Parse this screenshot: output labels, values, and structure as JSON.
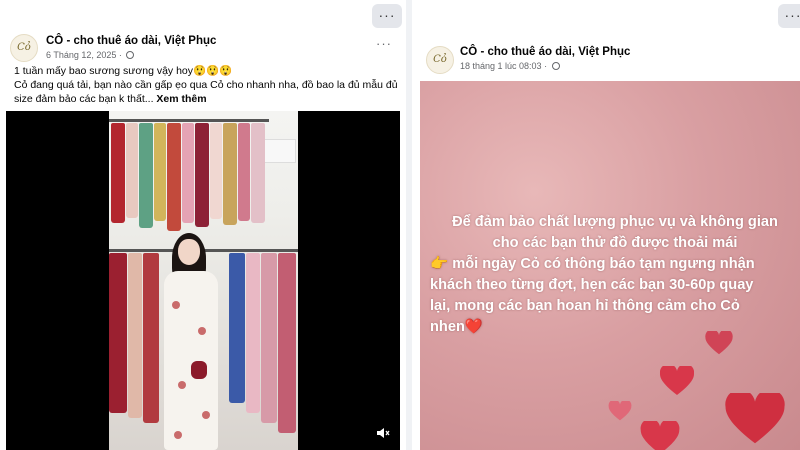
{
  "post_left": {
    "page_name": "CÔ - cho thuê áo dài, Việt Phục",
    "timestamp": "6 Tháng 12, 2025 ·",
    "caption_line1": "1 tuần mấy bao sương sương vậy hoy😲😲😲",
    "caption_line2": "Cỏ đang quá tải, bạn nào cần gấp ẹo qua Cỏ cho nhanh nha, đồ bao la đủ mẫu đủ size đảm bảo các bạn k thất...",
    "see_more": "Xem thêm",
    "avatar_text": "Cỏ",
    "more_label": "···"
  },
  "post_right": {
    "page_name": "CÔ - cho thuê áo dài, Việt Phục",
    "timestamp": "18 tháng 1 lúc 08:03 ·",
    "avatar_text": "Cỏ",
    "more_label": "···",
    "image_text": {
      "line1": "Để đảm bảo chất lượng phục vụ và không gian",
      "line2": "cho các bạn thử đồ được thoải mái",
      "line3": "👉 mỗi ngày Cỏ có thông báo tạm ngưng nhận",
      "line4": "khách theo từng đợt, hẹn các bạn 30-60p quay",
      "line5": "lại, mong các bạn hoan hỉ thông cảm cho Cỏ",
      "line6": "nhen❤️"
    }
  },
  "top_more_label": "···",
  "colors": {
    "heart": "#d8374a",
    "overlay_bg": "#d99fa2",
    "accent_text": "#050505"
  }
}
